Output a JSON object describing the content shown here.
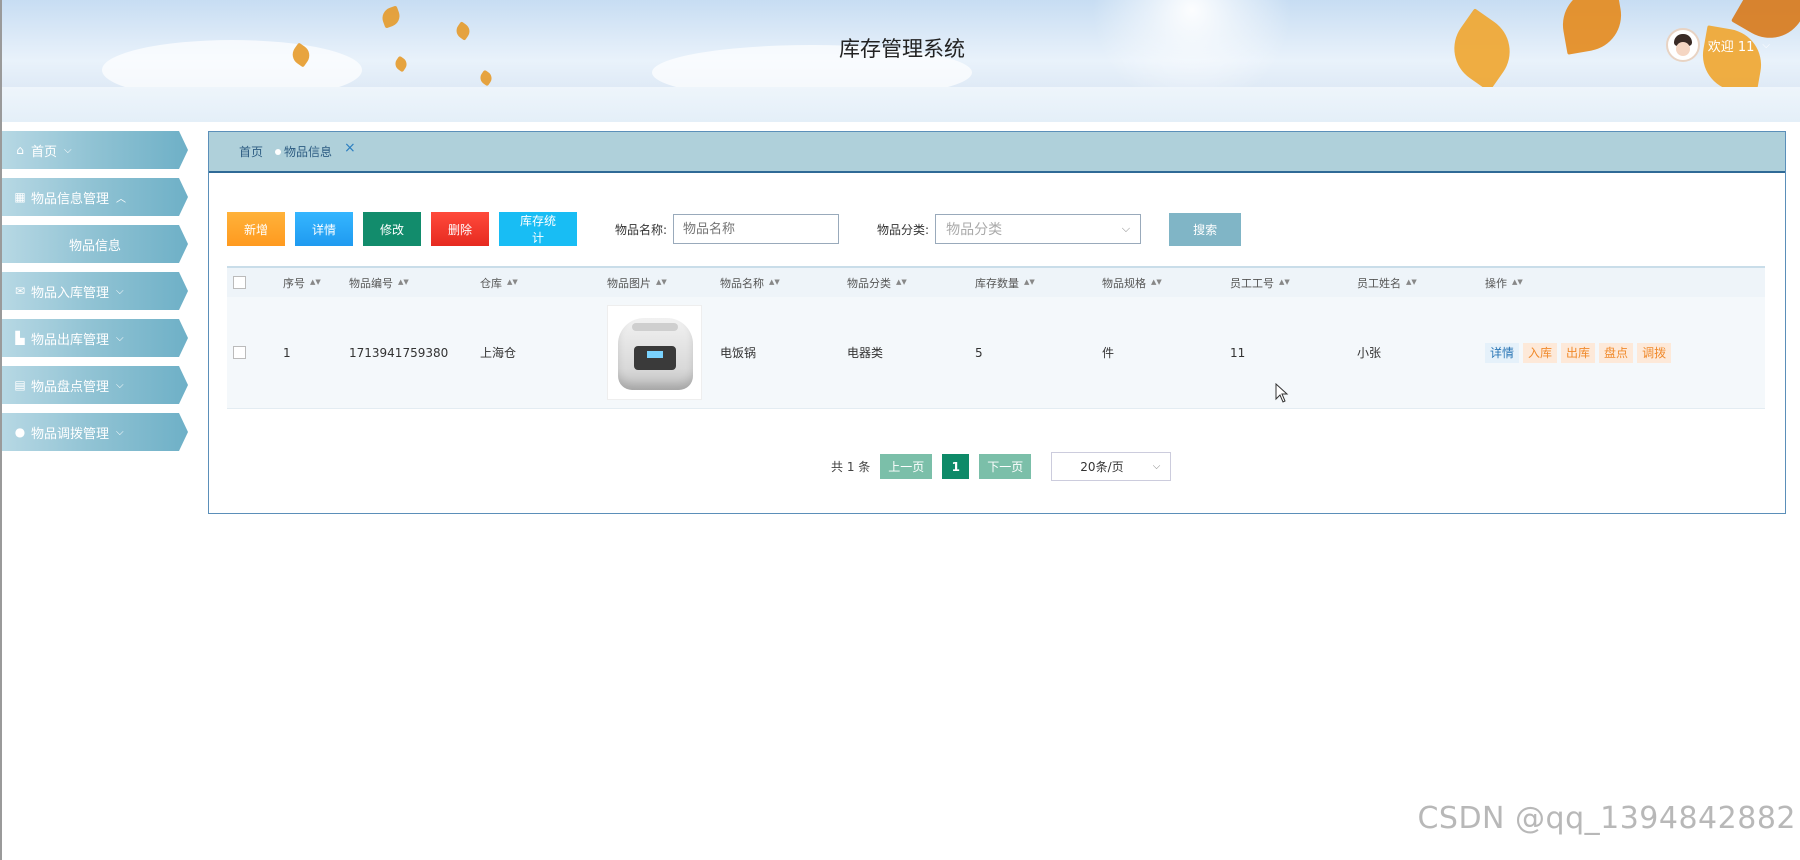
{
  "header": {
    "title": "库存管理系统",
    "user_greeting": "欢迎 11"
  },
  "sidebar": {
    "items": [
      {
        "label": "首页",
        "icon": "home-icon",
        "chevron": "down"
      },
      {
        "label": "物品信息管理",
        "icon": "grid-icon",
        "chevron": "up"
      },
      {
        "label": "物品信息",
        "icon": "",
        "chevron": ""
      },
      {
        "label": "物品入库管理",
        "icon": "mail-icon",
        "chevron": "down"
      },
      {
        "label": "物品出库管理",
        "icon": "box-out-icon",
        "chevron": "down"
      },
      {
        "label": "物品盘点管理",
        "icon": "drawer-icon",
        "chevron": "down"
      },
      {
        "label": "物品调拨管理",
        "icon": "circle-icon",
        "chevron": "down"
      }
    ]
  },
  "tabs": {
    "home": "首页",
    "current": "物品信息",
    "close": "×"
  },
  "toolbar": {
    "add": "新增",
    "detail": "详情",
    "edit": "修改",
    "delete": "删除",
    "stats": "库存统计",
    "name_label": "物品名称:",
    "name_placeholder": "物品名称",
    "category_label": "物品分类:",
    "category_placeholder": "物品分类",
    "search": "搜索"
  },
  "table": {
    "headers": [
      "序号",
      "物品编号",
      "仓库",
      "物品图片",
      "物品名称",
      "物品分类",
      "库存数量",
      "物品规格",
      "员工工号",
      "员工姓名",
      "操作"
    ],
    "rows": [
      {
        "index": "1",
        "code": "1713941759380",
        "warehouse": "上海仓",
        "image": "rice-cooker",
        "name": "电饭锅",
        "category": "电器类",
        "quantity": "5",
        "unit": "件",
        "employee_no": "11",
        "employee_name": "小张",
        "actions": [
          "详情",
          "入库",
          "出库",
          "盘点",
          "调拨"
        ]
      }
    ]
  },
  "pagination": {
    "total": "共 1 条",
    "prev": "上一页",
    "page": "1",
    "next": "下一页",
    "page_size": "20条/页"
  },
  "watermark": "CSDN @qq_1394842882",
  "colors": {
    "accent": "#0e8a68",
    "tab_bar": "#afd0da",
    "sidebar": "#8fc2d3"
  }
}
